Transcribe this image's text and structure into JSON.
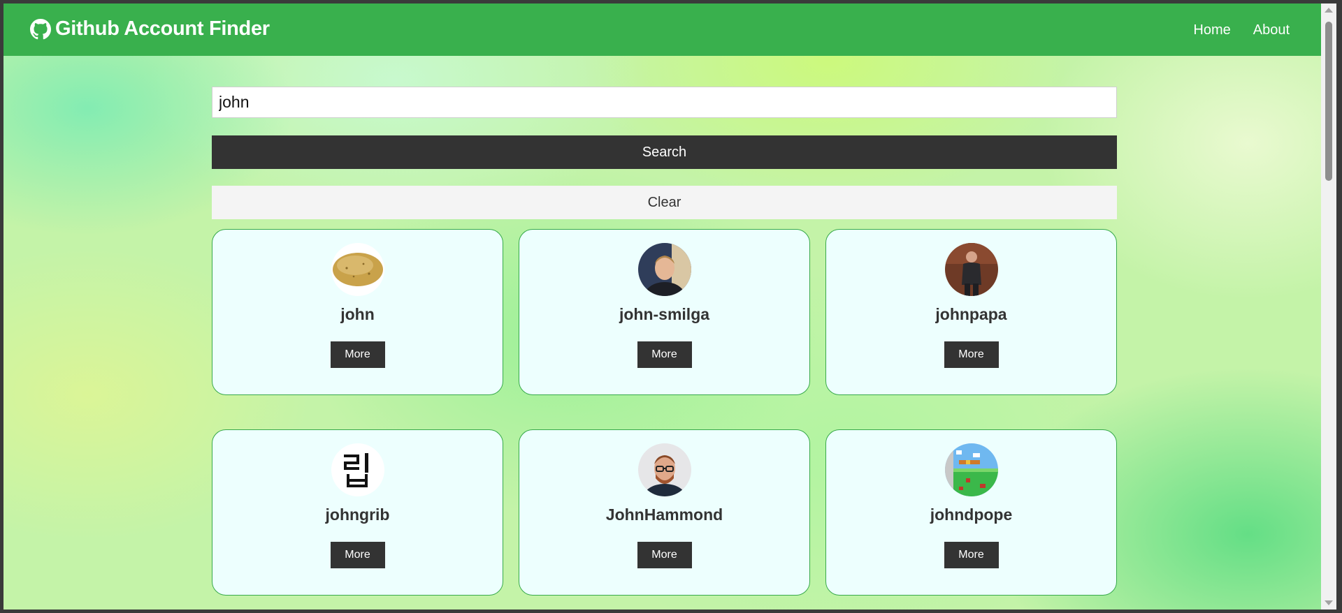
{
  "navbar": {
    "title": "Github Account Finder",
    "logo_icon": "github-icon",
    "links": [
      {
        "label": "Home"
      },
      {
        "label": "About"
      }
    ]
  },
  "search": {
    "value": "john",
    "placeholder": "",
    "search_label": "Search",
    "clear_label": "Clear"
  },
  "users": [
    {
      "login": "john",
      "more_label": "More",
      "avatar": "potato-avatar"
    },
    {
      "login": "john-smilga",
      "more_label": "More",
      "avatar": "man-portrait-avatar"
    },
    {
      "login": "johnpapa",
      "more_label": "More",
      "avatar": "man-standing-avatar"
    },
    {
      "login": "johngrib",
      "more_label": "More",
      "avatar": "korean-character-avatar"
    },
    {
      "login": "JohnHammond",
      "more_label": "More",
      "avatar": "man-glasses-avatar"
    },
    {
      "login": "johndpope",
      "more_label": "More",
      "avatar": "pixel-game-avatar"
    }
  ],
  "colors": {
    "navbar": "#39b04d",
    "dark_button": "#333333",
    "card_background": "#edfffe",
    "card_border": "#37a94b"
  }
}
